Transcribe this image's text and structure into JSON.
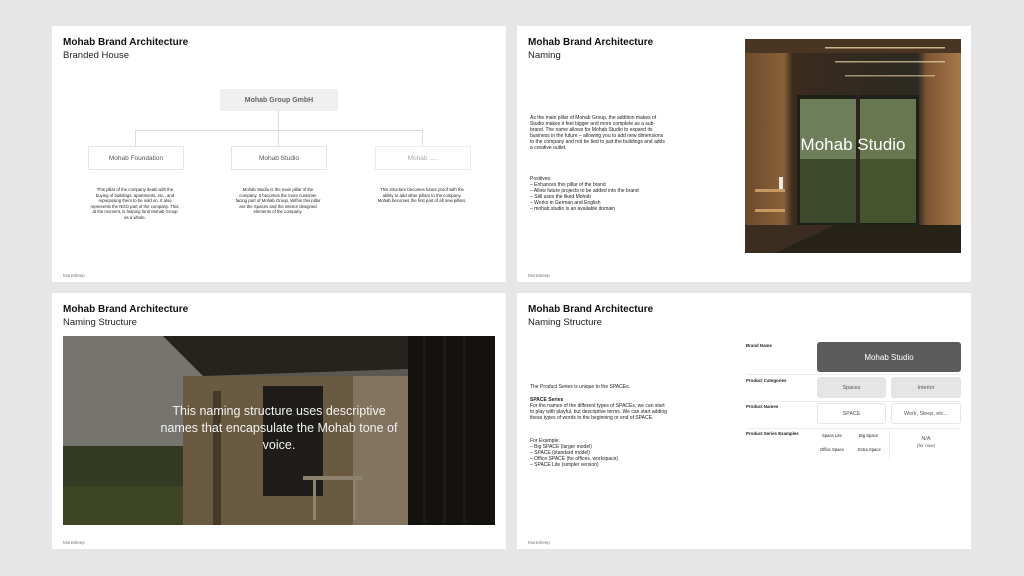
{
  "slides": [
    {
      "title": "Mohab Brand Architecture",
      "subtitle": "Branded House",
      "footer": "MoreSleep",
      "root": "Mohab Group GmbH",
      "children": [
        {
          "label": "Mohab Foundation",
          "desc": "This pillar of the company deals with the buying of buildings, apartments, etc., and repurposing them to be sold on. It also represents the NGO part of the company. This, at the moment, is helping fund Mohab Group as a whole."
        },
        {
          "label": "Mohab Studio",
          "desc": "Mohab Studio is the main pillar of the company. It becomes the more customer facing part of Mohab Group. Within this pillar are the Spaces and the interior designed elements of the company."
        },
        {
          "label": "Mohab .....",
          "desc": "This structure becomes future proof with the ability to add other pillars to the company. Mohab becomes the first part of all new pillars."
        }
      ]
    },
    {
      "title": "Mohab Brand Architecture",
      "subtitle": "Naming",
      "footer": "MoreSleep",
      "body": "As the main pillar of Mohab Group, the addition makes of Studio makes it feel bigger and more complete as a sub-brand. The name allows for Mohab Studio to expand its business in the future – allowing you to add new dimensions to the company and not be tied to just the buildings and adds a creative outlet.",
      "positives_title": "Positives:",
      "positives": [
        "– Enhances this pillar of the brand",
        "– Allow future projects to be added into the brand",
        "– Still uses the liked Mohab",
        "– Works in German and English",
        "– mohab.studio is an available domain"
      ],
      "image_text": "Mohab Studio"
    },
    {
      "title": "Mohab Brand Architecture",
      "subtitle": "Naming Structure",
      "footer": "MoreSleep",
      "image_text": "This naming structure uses descriptive names that encapsulate the Mohab tone of voice."
    },
    {
      "title": "Mohab Brand Architecture",
      "subtitle": "Naming Structure",
      "footer": "MoreSleep",
      "intro": "The Product Series is unique to the SPACEs.",
      "series_title": "SPACE Series",
      "series_body": "For the names of the different types of SPACEs, we can start to play with playful, but descriptive terms. We can start adding these types of words to the beginning or end of SPACE.",
      "example_title": "For Example:",
      "examples": [
        "– Big SPACE (larger model)",
        "– SPACE (standard model)",
        "– Office SPACE (for offices, workspace)",
        "– SPACE Lite (simpler version)"
      ],
      "table": {
        "brand_name_label": "Brand Name",
        "brand_name": "Mohab Studio",
        "categories_label": "Product Categories",
        "categories": [
          "Spaces",
          "Interior"
        ],
        "names_label": "Product Names",
        "names": [
          "SPACE",
          "Work, Sleep, etc..."
        ],
        "series_label": "Product Series Examples",
        "series": [
          "Space Lite",
          "Big Space",
          "Office Space",
          "Extra Space"
        ],
        "series_na": "N/A",
        "series_na_note": "(for now)"
      }
    }
  ],
  "colors": {
    "page": "#e6e6e6",
    "slide": "#ffffff",
    "dark_pill": "#5c5c5c",
    "light_pill": "#e5e5e5"
  }
}
